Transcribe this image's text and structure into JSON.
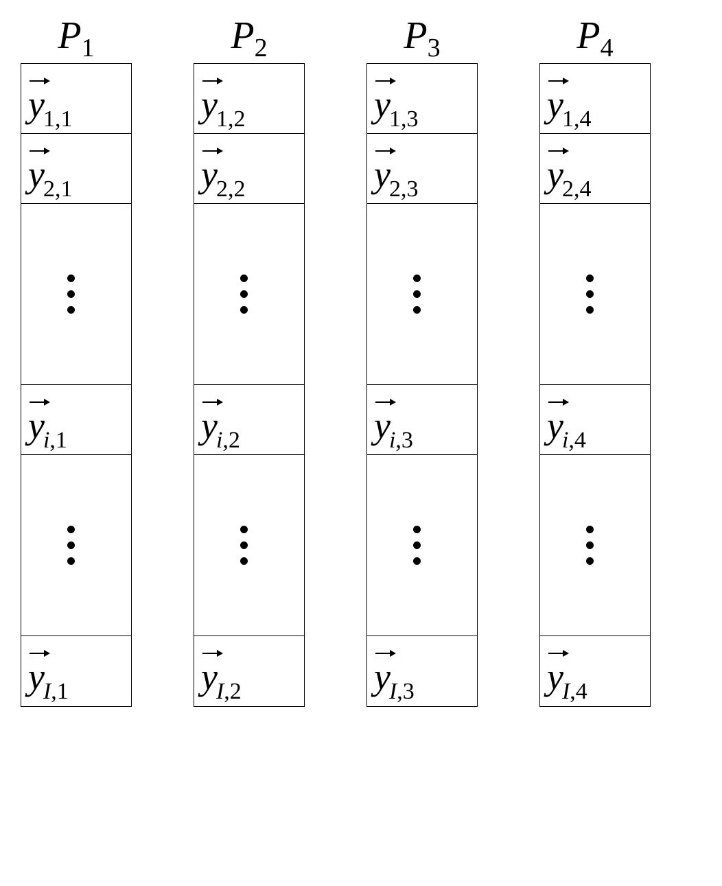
{
  "columns": [
    {
      "header_letter": "P",
      "header_sub": "1",
      "cells": [
        {
          "type": "vector",
          "letter": "y",
          "row": "1",
          "col": "1"
        },
        {
          "type": "vector",
          "letter": "y",
          "row": "2",
          "col": "1"
        },
        {
          "type": "vdots"
        },
        {
          "type": "vector",
          "letter": "y",
          "row": "i",
          "col": "1"
        },
        {
          "type": "vdots"
        },
        {
          "type": "vector",
          "letter": "y",
          "row": "I",
          "col": "1"
        }
      ]
    },
    {
      "header_letter": "P",
      "header_sub": "2",
      "cells": [
        {
          "type": "vector",
          "letter": "y",
          "row": "1",
          "col": "2"
        },
        {
          "type": "vector",
          "letter": "y",
          "row": "2",
          "col": "2"
        },
        {
          "type": "vdots"
        },
        {
          "type": "vector",
          "letter": "y",
          "row": "i",
          "col": "2"
        },
        {
          "type": "vdots"
        },
        {
          "type": "vector",
          "letter": "y",
          "row": "I",
          "col": "2"
        }
      ]
    },
    {
      "header_letter": "P",
      "header_sub": "3",
      "cells": [
        {
          "type": "vector",
          "letter": "y",
          "row": "1",
          "col": "3"
        },
        {
          "type": "vector",
          "letter": "y",
          "row": "2",
          "col": "3"
        },
        {
          "type": "vdots"
        },
        {
          "type": "vector",
          "letter": "y",
          "row": "i",
          "col": "3"
        },
        {
          "type": "vdots"
        },
        {
          "type": "vector",
          "letter": "y",
          "row": "I",
          "col": "3"
        }
      ]
    },
    {
      "header_letter": "P",
      "header_sub": "4",
      "cells": [
        {
          "type": "vector",
          "letter": "y",
          "row": "1",
          "col": "4"
        },
        {
          "type": "vector",
          "letter": "y",
          "row": "2",
          "col": "4"
        },
        {
          "type": "vdots"
        },
        {
          "type": "vector",
          "letter": "y",
          "row": "i",
          "col": "4"
        },
        {
          "type": "vdots"
        },
        {
          "type": "vector",
          "letter": "y",
          "row": "I",
          "col": "4"
        }
      ]
    }
  ]
}
